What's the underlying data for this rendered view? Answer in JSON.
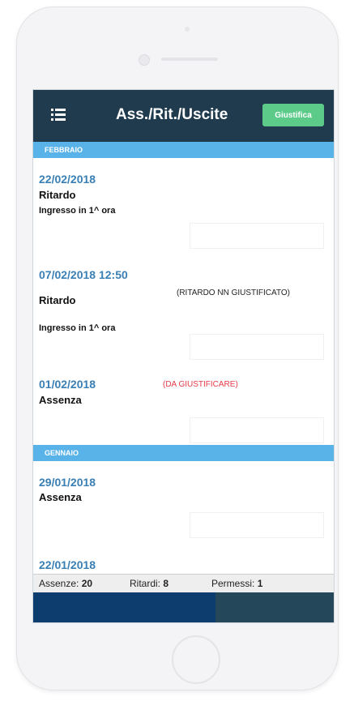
{
  "app": {
    "title": "Ass./Rit./Uscite",
    "justify_button": "Giustifica",
    "menu_icon": "hamburger-menu-icon"
  },
  "colors": {
    "header": "#1f3b4d",
    "section": "#5ab3e8",
    "button": "#5ccb8a",
    "date": "#3a7fb4",
    "warning": "#e53a45",
    "bottom_left": "#0c3d6e",
    "bottom_right": "#24475a"
  },
  "sections": [
    {
      "label": "FEBBRAIO",
      "entries": [
        {
          "date": "22/02/2018",
          "type": "Ritardo",
          "detail": "Ingresso in 1^ ora",
          "note": ""
        },
        {
          "date": "07/02/2018 12:50",
          "type": "Ritardo",
          "detail": "Ingresso in 1^ ora",
          "note": "(RITARDO NN GIUSTIFICATO)"
        },
        {
          "date": "01/02/2018",
          "type": "Assenza",
          "detail": "",
          "note": "(DA GIUSTIFICARE)"
        }
      ]
    },
    {
      "label": "GENNAIO",
      "entries": [
        {
          "date": "29/01/2018",
          "type": "Assenza",
          "detail": "",
          "note": ""
        },
        {
          "date": "22/01/2018",
          "type": "",
          "detail": "",
          "note": ""
        }
      ]
    }
  ],
  "footer": {
    "assenze_label": "Assenze:",
    "assenze_value": "20",
    "ritardi_label": "Ritardi:",
    "ritardi_value": "8",
    "permessi_label": "Permessi:",
    "permessi_value": "1"
  }
}
